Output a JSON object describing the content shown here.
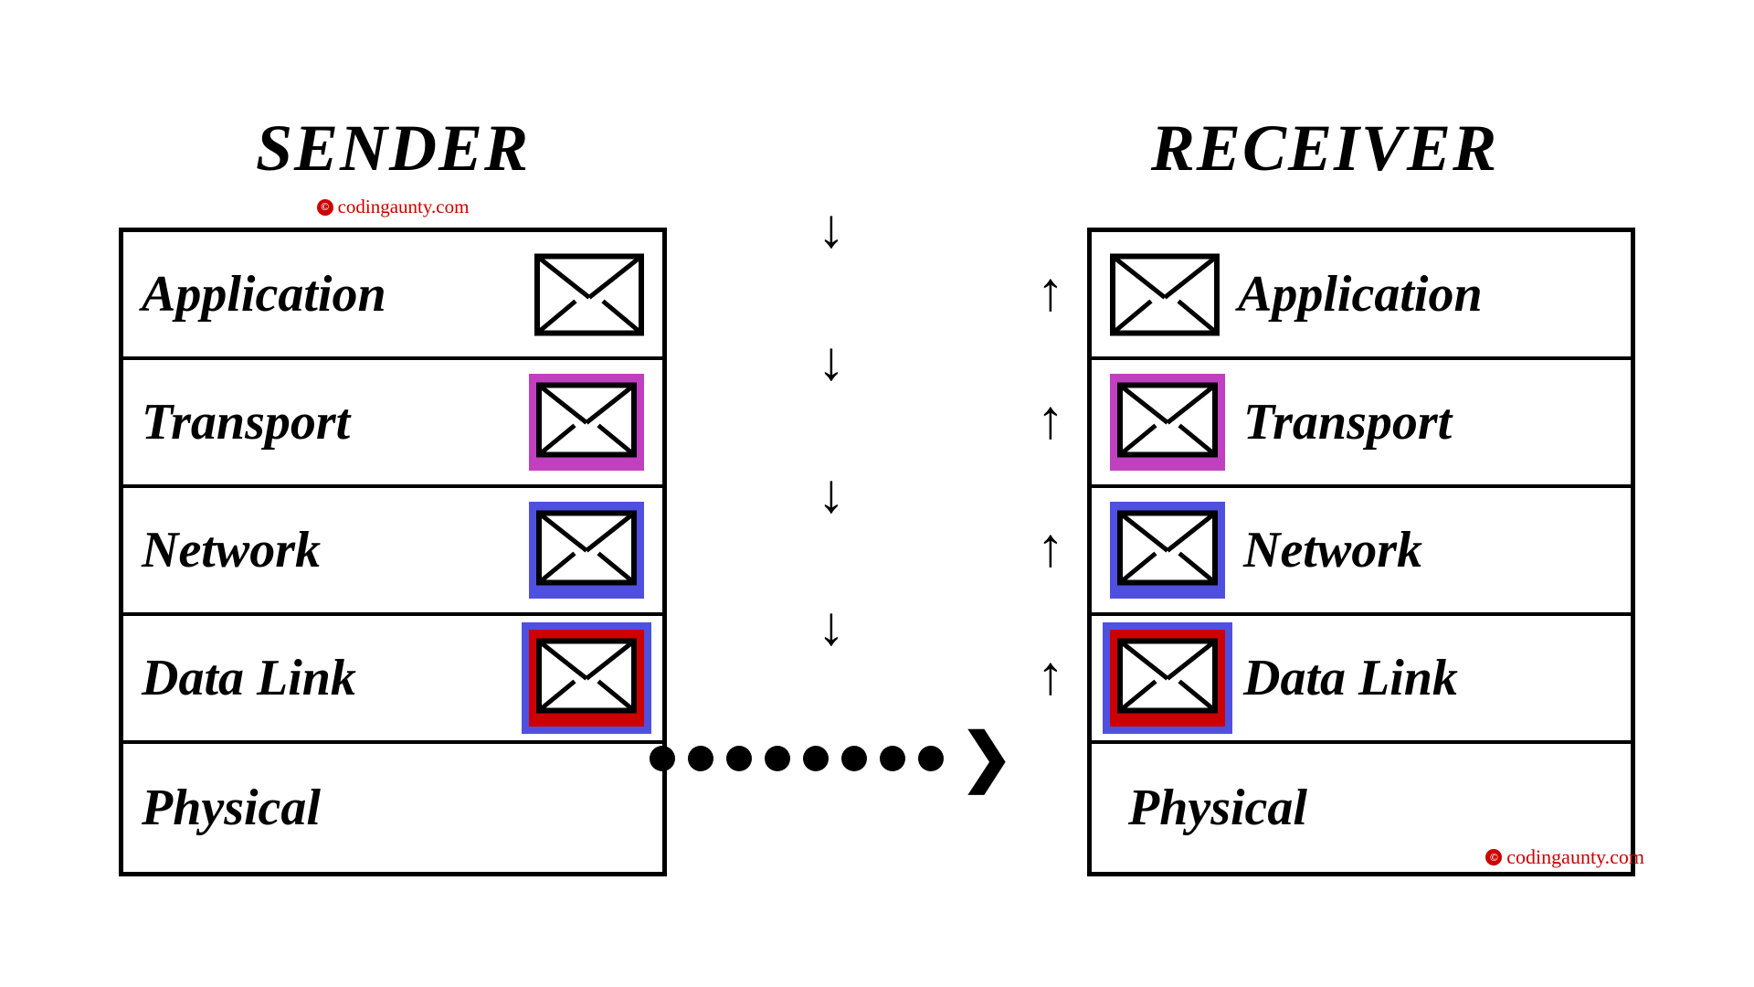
{
  "sender": {
    "title": "SENDER",
    "watermark": "codingaunty.com"
  },
  "receiver": {
    "title": "RECEIVER",
    "watermark": "codingaunty.com"
  },
  "layers": {
    "application": "Application",
    "transport": "Transport",
    "network": "Network",
    "data_link": "Data Link",
    "physical": "Physical"
  },
  "copyright_symbol": "©"
}
